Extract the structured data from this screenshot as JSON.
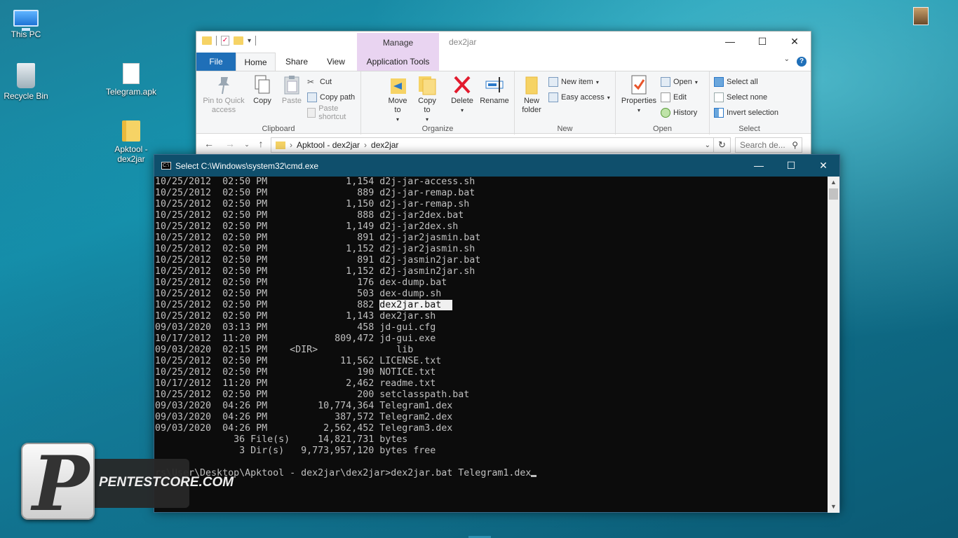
{
  "desktop": {
    "icons": [
      {
        "label": "This PC"
      },
      {
        "label": "Recycle Bin"
      },
      {
        "label": "Telegram.apk"
      },
      {
        "label": "Apktool - dex2jar"
      }
    ]
  },
  "explorer": {
    "title": "dex2jar",
    "manage_tab": "Manage",
    "tabs": {
      "file": "File",
      "home": "Home",
      "share": "Share",
      "view": "View",
      "app_tools": "Application Tools"
    },
    "clipboard": {
      "group": "Clipboard",
      "pin": "Pin to Quick access",
      "copy": "Copy",
      "paste": "Paste",
      "cut": "Cut",
      "copy_path": "Copy path",
      "paste_shortcut": "Paste shortcut"
    },
    "organize": {
      "group": "Organize",
      "move_to": "Move to",
      "copy_to": "Copy to",
      "delete": "Delete",
      "rename": "Rename"
    },
    "new": {
      "group": "New",
      "new_folder": "New folder",
      "new_item": "New item",
      "easy_access": "Easy access"
    },
    "open": {
      "group": "Open",
      "properties": "Properties",
      "open": "Open",
      "edit": "Edit",
      "history": "History"
    },
    "select": {
      "group": "Select",
      "select_all": "Select all",
      "select_none": "Select none",
      "invert": "Invert selection"
    },
    "address": {
      "crumb1": "Apktool - dex2jar",
      "crumb2": "dex2jar",
      "search_placeholder": "Search de..."
    }
  },
  "cmd": {
    "title": "Select C:\\Windows\\system32\\cmd.exe",
    "listing": [
      {
        "date": "10/25/2012",
        "time": "02:50 PM",
        "size": "1,154",
        "name": "d2j-jar-access.sh"
      },
      {
        "date": "10/25/2012",
        "time": "02:50 PM",
        "size": "889",
        "name": "d2j-jar-remap.bat"
      },
      {
        "date": "10/25/2012",
        "time": "02:50 PM",
        "size": "1,150",
        "name": "d2j-jar-remap.sh"
      },
      {
        "date": "10/25/2012",
        "time": "02:50 PM",
        "size": "888",
        "name": "d2j-jar2dex.bat"
      },
      {
        "date": "10/25/2012",
        "time": "02:50 PM",
        "size": "1,149",
        "name": "d2j-jar2dex.sh"
      },
      {
        "date": "10/25/2012",
        "time": "02:50 PM",
        "size": "891",
        "name": "d2j-jar2jasmin.bat"
      },
      {
        "date": "10/25/2012",
        "time": "02:50 PM",
        "size": "1,152",
        "name": "d2j-jar2jasmin.sh"
      },
      {
        "date": "10/25/2012",
        "time": "02:50 PM",
        "size": "891",
        "name": "d2j-jasmin2jar.bat"
      },
      {
        "date": "10/25/2012",
        "time": "02:50 PM",
        "size": "1,152",
        "name": "d2j-jasmin2jar.sh"
      },
      {
        "date": "10/25/2012",
        "time": "02:50 PM",
        "size": "176",
        "name": "dex-dump.bat"
      },
      {
        "date": "10/25/2012",
        "time": "02:50 PM",
        "size": "503",
        "name": "dex-dump.sh"
      },
      {
        "date": "10/25/2012",
        "time": "02:50 PM",
        "size": "882",
        "name": "dex2jar.bat",
        "selected": true
      },
      {
        "date": "10/25/2012",
        "time": "02:50 PM",
        "size": "1,143",
        "name": "dex2jar.sh"
      },
      {
        "date": "09/03/2020",
        "time": "03:13 PM",
        "size": "458",
        "name": "jd-gui.cfg"
      },
      {
        "date": "10/17/2012",
        "time": "11:20 PM",
        "size": "809,472",
        "name": "jd-gui.exe"
      },
      {
        "date": "09/03/2020",
        "time": "02:15 PM",
        "dir": "<DIR>",
        "name": "lib"
      },
      {
        "date": "10/25/2012",
        "time": "02:50 PM",
        "size": "11,562",
        "name": "LICENSE.txt"
      },
      {
        "date": "10/25/2012",
        "time": "02:50 PM",
        "size": "190",
        "name": "NOTICE.txt"
      },
      {
        "date": "10/17/2012",
        "time": "11:20 PM",
        "size": "2,462",
        "name": "readme.txt"
      },
      {
        "date": "10/25/2012",
        "time": "02:50 PM",
        "size": "200",
        "name": "setclasspath.bat"
      },
      {
        "date": "09/03/2020",
        "time": "04:26 PM",
        "size": "10,774,364",
        "name": "Telegram1.dex"
      },
      {
        "date": "09/03/2020",
        "time": "04:26 PM",
        "size": "387,572",
        "name": "Telegram2.dex"
      },
      {
        "date": "09/03/2020",
        "time": "04:26 PM",
        "size": "2,562,452",
        "name": "Telegram3.dex"
      }
    ],
    "summary_files": "              36 File(s)     14,821,731 bytes",
    "summary_dirs": "               3 Dir(s)   9,773,957,120 bytes free",
    "prompt_line": "rs\\User\\Desktop\\Apktool - dex2jar\\dex2jar>dex2jar.bat Telegram1.dex"
  },
  "watermark": {
    "text": "PENTESTCORE.COM"
  },
  "colors": {
    "cmd_titlebar": "#0f4f6c",
    "file_tab": "#1f6fb8",
    "manage_tab": "#e9d4f1"
  }
}
